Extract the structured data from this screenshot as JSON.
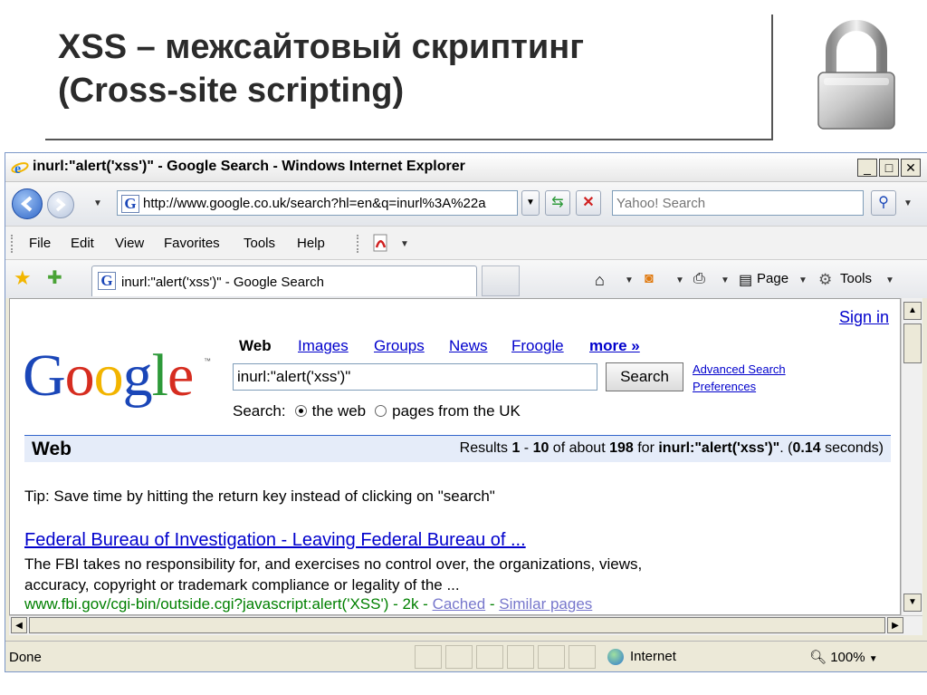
{
  "slide": {
    "title_line1": "XSS – межсайтовый скриптинг",
    "title_line2": "(Cross-site scripting)"
  },
  "window": {
    "title": "inurl:\"alert('xss')\" - Google Search - Windows Internet Explorer",
    "minimize": "_",
    "maximize": "□",
    "close": "✕"
  },
  "addressbar": {
    "url": "http://www.google.co.uk/search?hl=en&q=inurl%3A%22a",
    "search_placeholder": "Yahoo! Search"
  },
  "menu": {
    "items": [
      "File",
      "Edit",
      "View",
      "Favorites",
      "Tools",
      "Help"
    ]
  },
  "tabs": {
    "active_label": "inurl:\"alert('xss')\" - Google Search"
  },
  "commandbar": {
    "page_label": "Page",
    "tools_label": "Tools"
  },
  "google": {
    "sign_in": "Sign in",
    "logo_letters": [
      "G",
      "o",
      "o",
      "g",
      "l",
      "e"
    ],
    "logo_colors": [
      "#1a46b8",
      "#d62d20",
      "#f2b400",
      "#1a46b8",
      "#2e9a3a",
      "#d62d20"
    ],
    "nav": {
      "web": "Web",
      "images": "Images",
      "groups": "Groups",
      "news": "News",
      "froogle": "Froogle",
      "more": "more »"
    },
    "query": "inurl:\"alert('xss')\"",
    "search_button": "Search",
    "advanced_search": "Advanced Search",
    "preferences": "Preferences",
    "scope_label": "Search:",
    "scope_web": "the web",
    "scope_uk": "pages from the UK"
  },
  "results": {
    "heading": "Web",
    "info_prefix": "Results ",
    "range_start": "1",
    "range_sep": " - ",
    "range_end": "10",
    "about_text": " of about ",
    "total": "198",
    "for_text": " for ",
    "query_bold": "inurl:\"alert('xss')\"",
    "time_prefix": ". (",
    "time": "0.14",
    "time_suffix": " seconds)",
    "tip": "Tip: Save time by hitting the return key instead of clicking on \"search\"",
    "items": [
      {
        "title": "Federal Bureau of Investigation - Leaving Federal Bureau of ...",
        "snippet_line1": "The FBI takes no responsibility for, and exercises no control over, the organizations, views,",
        "snippet_line2": "accuracy, copyright or trademark compliance or legality of the ...",
        "url": "www.fbi.gov/cgi-bin/outside.cgi?javascript:alert('XSS')",
        "size": " - 2k - ",
        "cached": "Cached",
        "sep": " - ",
        "similar": "Similar pages"
      }
    ]
  },
  "status": {
    "done": "Done",
    "zone": "Internet",
    "zoom": "100%"
  }
}
